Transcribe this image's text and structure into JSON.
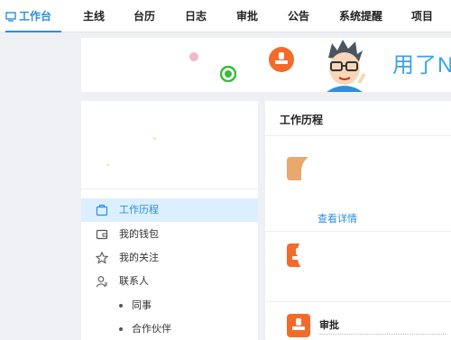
{
  "nav": {
    "workbench": "工作台",
    "mainline": "主线",
    "calendar": "台历",
    "log": "日志",
    "approval": "审批",
    "notice": "公告",
    "reminder": "系统提醒",
    "project": "项目"
  },
  "banner": {
    "slogan": "用了N"
  },
  "sidebar": {
    "items": [
      {
        "label": "工作历程"
      },
      {
        "label": "我的钱包"
      },
      {
        "label": "我的关注"
      },
      {
        "label": "联系人"
      }
    ],
    "sub_items": [
      {
        "label": "同事"
      },
      {
        "label": "合作伙伴"
      }
    ]
  },
  "history": {
    "title": "工作历程",
    "detail_link": "查看详情",
    "approval_title": "审批"
  },
  "colors": {
    "accent": "#2a8ee0",
    "orange": "#f36b2a",
    "active_bg": "#dcefff"
  }
}
